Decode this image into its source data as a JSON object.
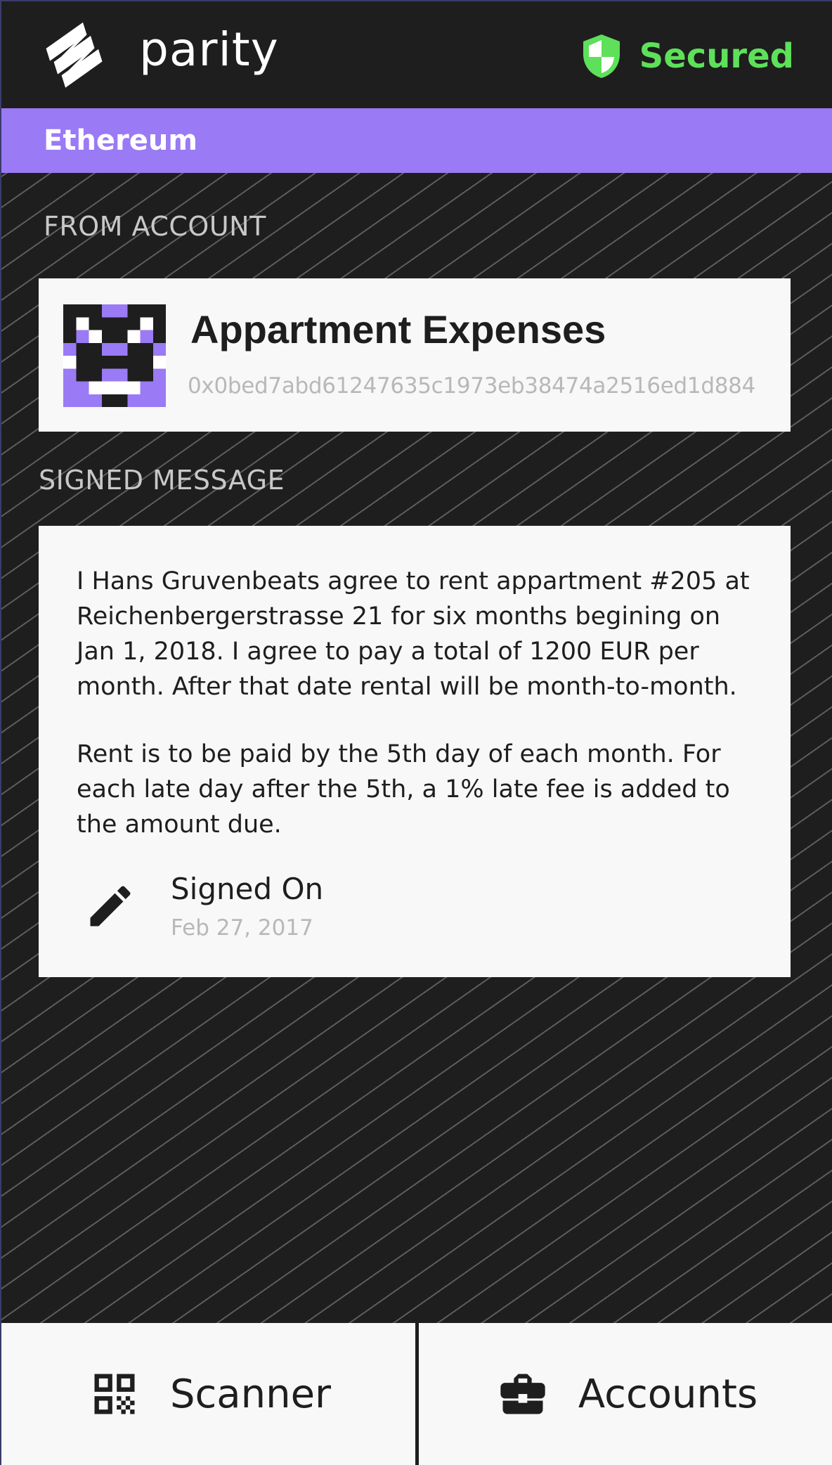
{
  "header": {
    "brand": "parity",
    "secured_label": "Secured",
    "logo_icon": "parity-logo-icon",
    "shield_icon": "shield-icon"
  },
  "network": {
    "label": "Ethereum"
  },
  "from_account": {
    "section_title": "FROM ACCOUNT",
    "name": "Appartment Expenses",
    "address": "0x0bed7abd61247635c1973eb38474a2516ed1d884"
  },
  "signed_message": {
    "section_title": "SIGNED MESSAGE",
    "paragraphs": [
      "I Hans Gruvenbeats agree to rent appartment #205 at Reichenbergerstrasse 21 for six months begining on Jan 1, 2018. I agree to pay a total of 1200 EUR per month. After that date rental will be month-to-month.",
      "Rent is to be paid by the 5th day of each month. For each late day after the 5th, a 1% late fee is added to the amount due."
    ],
    "signed_label": "Signed On",
    "signed_date": "Feb 27, 2017"
  },
  "bottom_nav": {
    "scanner_label": "Scanner",
    "accounts_label": "Accounts"
  },
  "colors": {
    "background": "#1e1e1e",
    "network_bar": "#9a7af5",
    "secured_green": "#5ee05a",
    "card": "#f8f8f8",
    "muted_text": "#b8b8b8"
  }
}
